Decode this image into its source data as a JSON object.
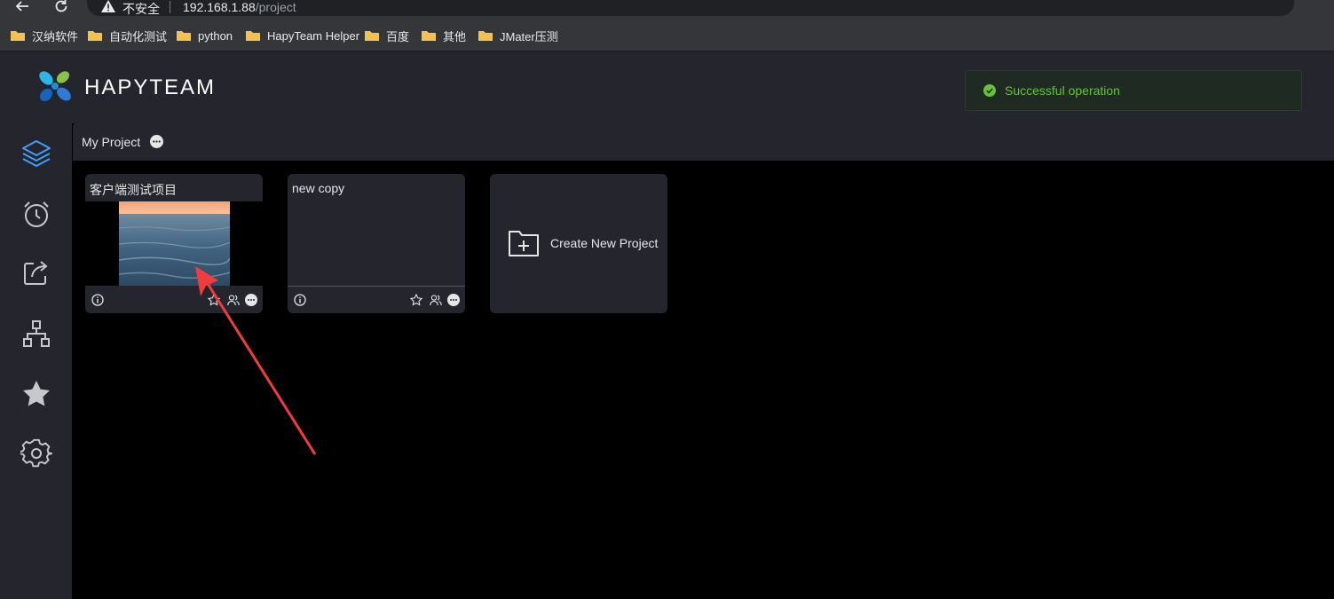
{
  "browser": {
    "insecure_label": "不安全",
    "url_host": "192.168.1.88",
    "url_path": "/project",
    "bookmarks": [
      "汉纳软件",
      "自动化测试",
      "python",
      "HapyTeam Helper",
      "百度",
      "其他",
      "JMater压测"
    ]
  },
  "app": {
    "brand": "HAPYTEAM",
    "toast": "Successful operation",
    "breadcrumb": "My Project"
  },
  "projects": [
    {
      "name": "客户端测试项目"
    },
    {
      "name": "new copy"
    }
  ],
  "create_label": "Create New Project",
  "colors": {
    "accent": "#409eff",
    "success": "#67c23a",
    "panel": "#25252e",
    "annotation": "#f03c3c"
  }
}
